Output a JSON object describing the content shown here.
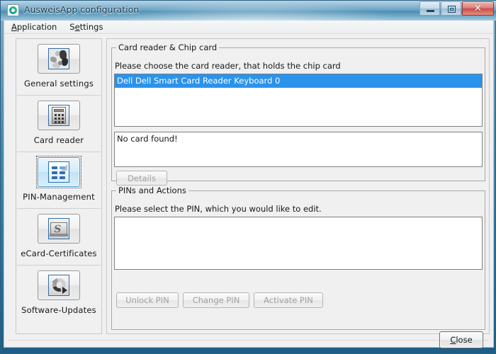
{
  "window": {
    "title": "AusweisApp configuration",
    "app_icon": "ausweisapp-ring-icon",
    "controls": {
      "minimize_label": "–",
      "maximize_label": "□",
      "close_label": "✕"
    }
  },
  "menubar": {
    "items": [
      {
        "label": "Application",
        "mnemonic": "A",
        "rest": "pplication"
      },
      {
        "label": "Settings",
        "mnemonic_prefix": "S",
        "mnemonic": "e",
        "rest": "ttings"
      }
    ]
  },
  "sidebar": {
    "items": [
      {
        "label": "General  settings",
        "icon": "world-map-icon",
        "selected": false
      },
      {
        "label": "Card reader",
        "icon": "card-reader-device-icon",
        "selected": false
      },
      {
        "label": "PIN-Management",
        "icon": "pin-keypad-icon",
        "selected": true
      },
      {
        "label": "eCard-Certificates",
        "icon": "certificate-seal-icon",
        "selected": false
      },
      {
        "label": "Software-Updates",
        "icon": "refresh-arrows-icon",
        "selected": false
      }
    ]
  },
  "card_reader_group": {
    "legend": "Card reader & Chip card",
    "hint": "Please choose the card reader, that holds the chip card",
    "reader_list": {
      "items": [
        "Dell Dell Smart Card Reader Keyboard 0"
      ],
      "selected_index": 0
    },
    "status_text": "No card found!",
    "details_button": {
      "label": "Details",
      "enabled": false
    }
  },
  "pins_group": {
    "legend": "PINs and Actions",
    "hint": "Please select the PIN, which you would like to edit.",
    "pin_list": {
      "items": []
    },
    "buttons": [
      {
        "label": "Unlock PIN",
        "enabled": false
      },
      {
        "label": "Change PIN",
        "enabled": false
      },
      {
        "label": "Activate PIN",
        "enabled": false
      }
    ]
  },
  "footer": {
    "close_button": {
      "label": "Close",
      "mnemonic": "C",
      "rest": "lose",
      "enabled": true,
      "is_default": true
    }
  },
  "colors": {
    "selection_blue": "#2a93ec",
    "titlebar_blue": "#4d8fb4",
    "window_bg": "#f0f0f0",
    "close_red": "#c64e45",
    "disabled_text": "#a0a0a0",
    "accent_icon_blue": "#2e6ea8"
  }
}
